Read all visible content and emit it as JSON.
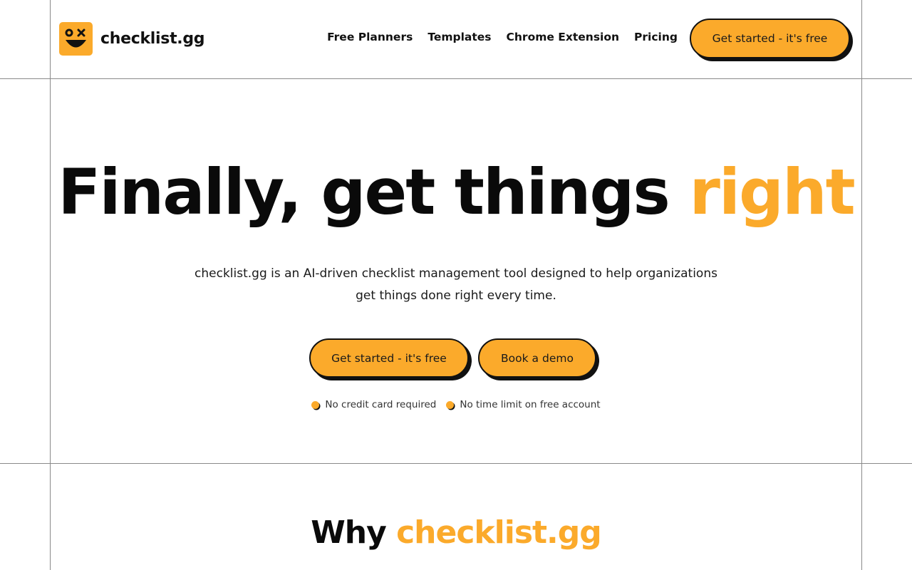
{
  "colors": {
    "accent": "#FBAA2B",
    "text": "#111111",
    "border": "#111111",
    "grid": "#8a8a8a"
  },
  "header": {
    "logo": {
      "icon": "smiley-logo-icon",
      "text": "checklist.gg"
    },
    "nav": [
      "Free Planners",
      "Templates",
      "Chrome Extension",
      "Pricing"
    ],
    "cta_label": "Get started - it's free"
  },
  "hero": {
    "title_main": "Finally, get things ",
    "title_accent": "right",
    "subtitle_line1": "checklist.gg is an AI-driven checklist management tool designed to help organizations",
    "subtitle_line2": "get things done right every time.",
    "primary_button": "Get started - it's free",
    "secondary_button": "Book a demo",
    "perks": [
      "No credit card required",
      "No time limit on free account"
    ]
  },
  "why": {
    "title_main": "Why ",
    "title_accent": "checklist.gg"
  }
}
